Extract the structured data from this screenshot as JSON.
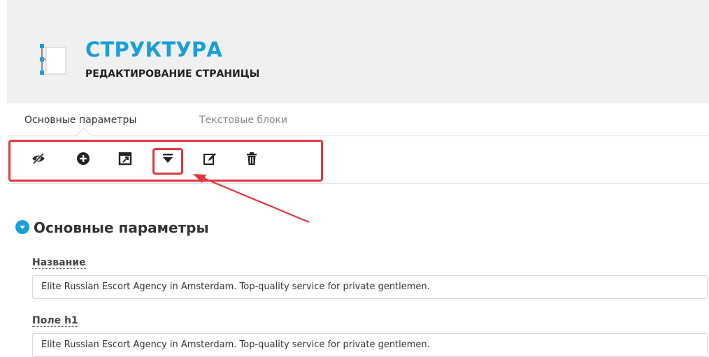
{
  "header": {
    "title": "СТРУКТУРА",
    "subtitle": "РЕДАКТИРОВАНИЕ СТРАНИЦЫ",
    "logo_icon": "structure-tree-icon"
  },
  "tabs": [
    {
      "label": "Основные параметры",
      "active": true
    },
    {
      "label": "Текстовые блоки",
      "active": false
    }
  ],
  "toolbar": {
    "icons": [
      "eye-slash-icon",
      "plus-circle-icon",
      "external-window-icon",
      "caret-down-icon",
      "edit-icon",
      "trash-icon"
    ],
    "highlighted": "caret-down-icon"
  },
  "section": {
    "title": "Основные параметры"
  },
  "fields": [
    {
      "label": "Название",
      "value": "Elite Russian Escort Agency in Amsterdam. Top-quality service for private gentlemen."
    },
    {
      "label": "Поле h1",
      "value": "Elite Russian Escort Agency in Amsterdam. Top-quality service for private gentlemen."
    }
  ],
  "colors": {
    "accent": "#1a9fd9",
    "annotation": "#e0393e",
    "header_bg": "#f0f0f0"
  }
}
